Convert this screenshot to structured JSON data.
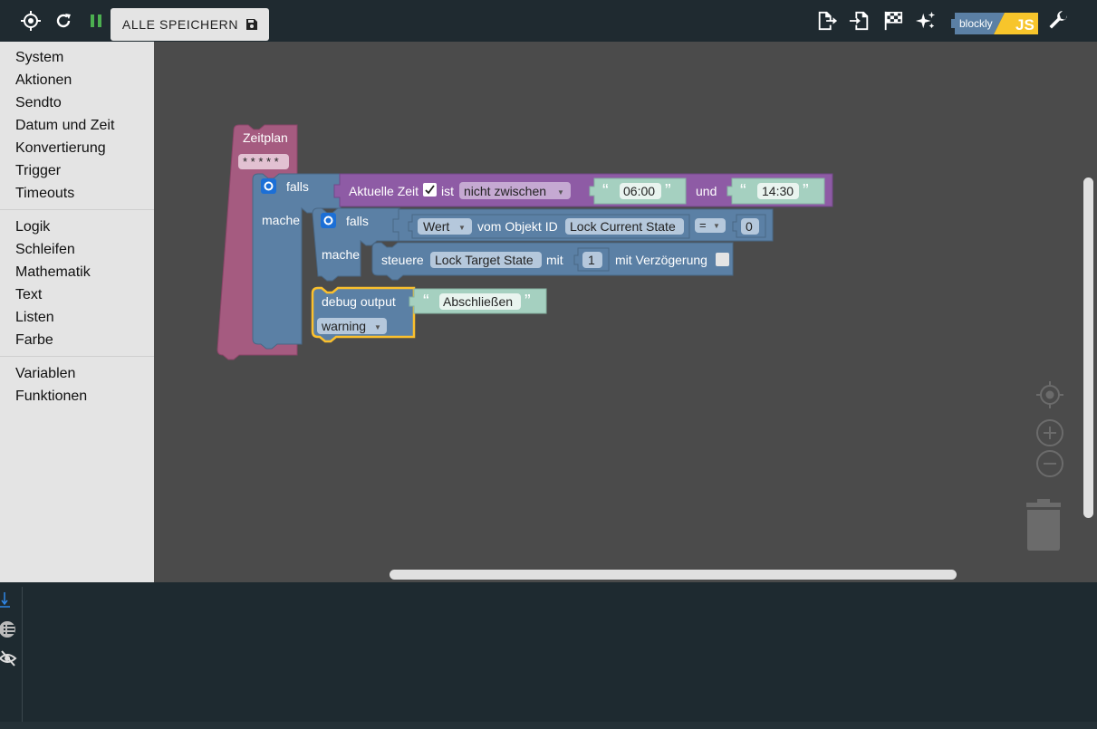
{
  "toolbar": {
    "save_label": "ALLE SPEICHERN",
    "logo_text": "blockly",
    "logo_js": "JS"
  },
  "sidebar": {
    "groups": [
      [
        "System",
        "Aktionen",
        "Sendto",
        "Datum und Zeit",
        "Konvertierung",
        "Trigger",
        "Timeouts"
      ],
      [
        "Logik",
        "Schleifen",
        "Mathematik",
        "Text",
        "Listen",
        "Farbe"
      ],
      [
        "Variablen",
        "Funktionen"
      ]
    ]
  },
  "blocks": {
    "schedule_label": "Zeitplan",
    "cron": "* * * * *",
    "if1_label": "falls",
    "do1_label": "mache",
    "time_label": "Aktuelle Zeit",
    "is_label": "ist",
    "compare_op": "nicht zwischen",
    "time_from": "06:00",
    "and_label": "und",
    "time_to": "14:30",
    "if2_label": "falls",
    "do2_label": "mache",
    "value_dropdown": "Wert",
    "object_label": "vom Objekt ID",
    "object_id": "Lock Current State",
    "equals_op": "=",
    "equals_value": "0",
    "control_label": "steuere",
    "control_target": "Lock Target State",
    "with_label": "mit",
    "control_value": "1",
    "delay_label": "mit Verzögerung",
    "debug_label": "debug output",
    "debug_text": "Abschließen",
    "debug_level": "warning"
  },
  "colors": {
    "schedule": "#a55b80",
    "logic": "#5b80a5",
    "time": "#8e5ba5",
    "text": "#a5d0c0",
    "selected": "#fbc02d"
  }
}
